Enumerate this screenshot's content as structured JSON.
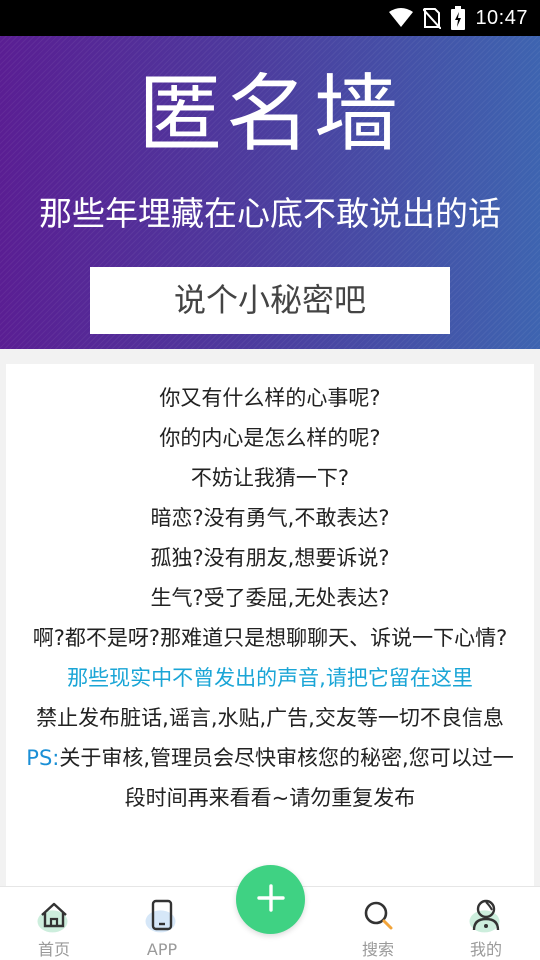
{
  "status_bar": {
    "time": "10:47",
    "icons": [
      "wifi-icon",
      "no-sim-icon",
      "battery-charging-icon"
    ]
  },
  "header": {
    "title": "匿名墙",
    "subtitle": "那些年埋藏在心底不敢说出的话",
    "cta_label": "说个小秘密吧"
  },
  "card": {
    "lines": [
      "你又有什么样的心事呢?",
      "你的内心是怎么样的呢?",
      "不妨让我猜一下?",
      "暗恋?没有勇气,不敢表达?",
      "孤独?没有朋友,想要诉说?",
      "生气?受了委屈,无处表达?",
      "啊?都不是呀?那难道只是想聊聊天、诉说一下心情?"
    ],
    "highlight": "那些现实中不曾发出的声音,请把它留在这里",
    "rules": "禁止发布脏话,谣言,水贴,广告,交友等一切不良信息",
    "ps_label": "PS:",
    "ps_text": "关于审核,管理员会尽快审核您的秘密,您可以过一段时间再来看看~请勿重复发布"
  },
  "bottom_nav": {
    "items": [
      {
        "label": "首页",
        "icon": "home-icon"
      },
      {
        "label": "APP",
        "icon": "phone-icon"
      },
      {
        "label": "搜索",
        "icon": "search-icon"
      },
      {
        "label": "我的",
        "icon": "profile-icon"
      }
    ],
    "fab_icon": "plus-icon"
  },
  "colors": {
    "header_gradient_start": "#5a1e93",
    "header_gradient_end": "#3e64b0",
    "highlight_text": "#1aa5d6",
    "fab": "#3fd283"
  }
}
